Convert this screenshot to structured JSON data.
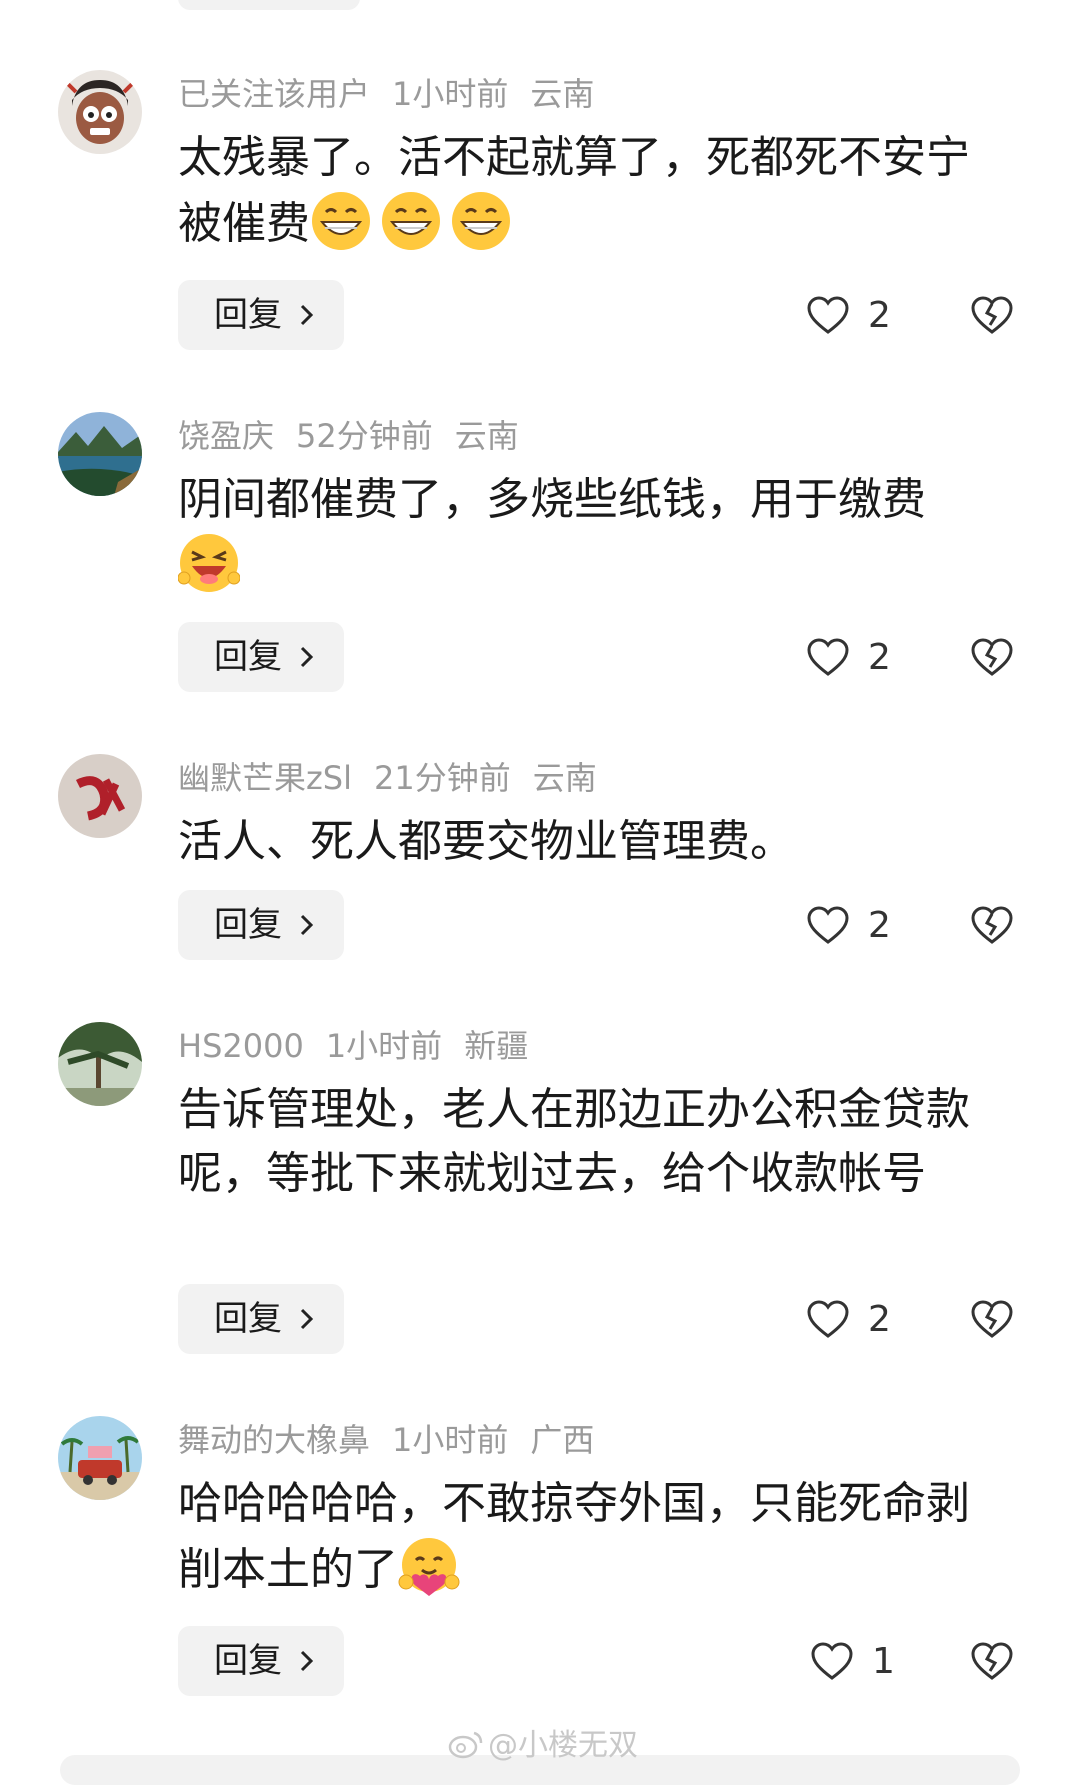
{
  "comments": [
    {
      "username": "已关注该用户",
      "time": "1小时前",
      "location": "云南",
      "text": "太残暴了。活不起就算了，死都死不安宁被催费",
      "emojis": [
        "grin-emoji",
        "grin-emoji",
        "grin-emoji"
      ],
      "reply_label": "回复",
      "likes": "2"
    },
    {
      "username": "饶盈庆",
      "time": "52分钟前",
      "location": "云南",
      "text": "阴间都催费了，多烧些纸钱，用于缴费",
      "emojis": [
        "laughing-emoji"
      ],
      "reply_label": "回复",
      "likes": "2"
    },
    {
      "username": "幽默芒果zSl",
      "time": "21分钟前",
      "location": "云南",
      "text": "活人、死人都要交物业管理费。",
      "emojis": [],
      "reply_label": "回复",
      "likes": "2"
    },
    {
      "username": "HS2000",
      "time": "1小时前",
      "location": "新疆",
      "text": "告诉管理处，老人在那边正办公积金贷款呢，等批下来就划过去，给个收款帐号",
      "emojis": [],
      "reply_label": "回复",
      "likes": "2"
    },
    {
      "username": "舞动的大橡鼻",
      "time": "1小时前",
      "location": "广西",
      "text": "哈哈哈哈哈，不敢掠夺外国，只能死命剥削本土的了",
      "emojis": [
        "hug-emoji"
      ],
      "reply_label": "回复",
      "likes": "1"
    }
  ],
  "watermark": "@小楼无双",
  "colors": {
    "meta_gray": "#9a9a9a",
    "button_bg": "#f2f2f2",
    "emoji_yellow": "#ffc83d"
  }
}
